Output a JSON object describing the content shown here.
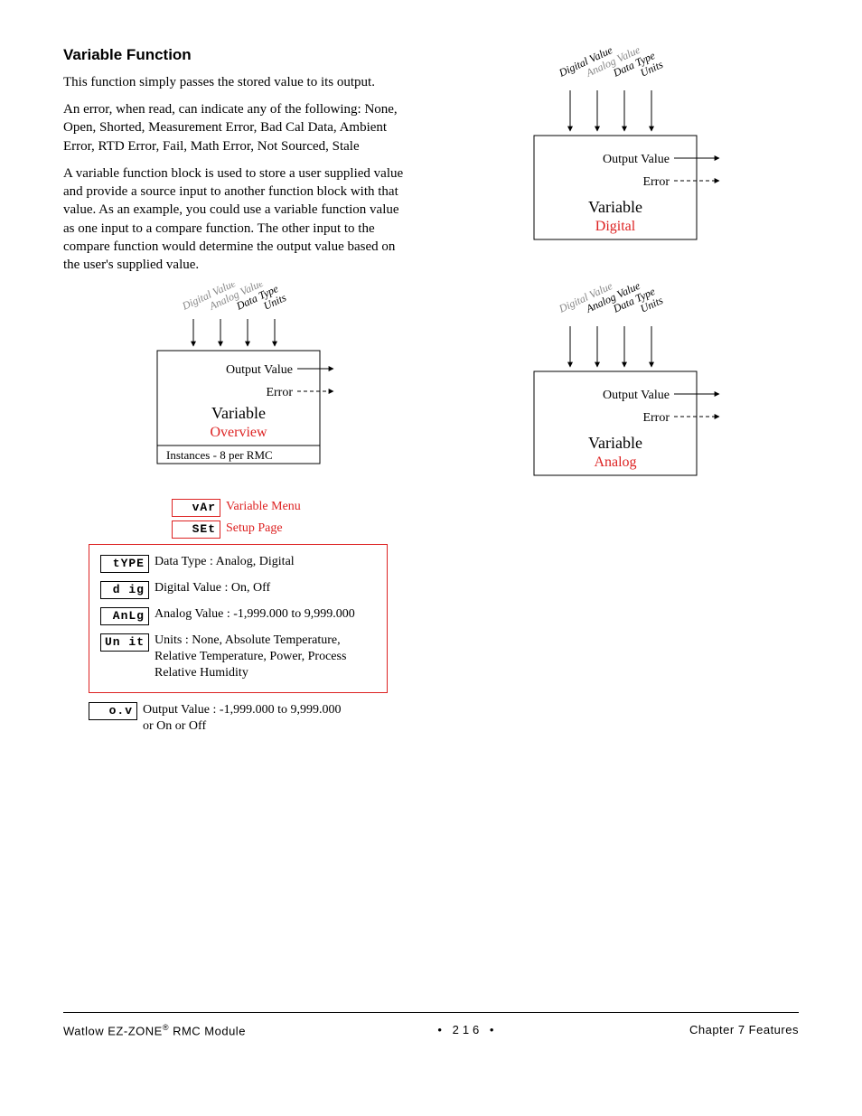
{
  "title": "Variable Function",
  "para1": "This function simply passes the stored value to its output.",
  "para2": "An error, when read, can indicate any of the following: None, Open, Shorted, Measurement Error, Bad Cal Data, Ambient Error, RTD Error, Fail, Math Error, Not Sourced, Stale",
  "para3": "A variable function block is used to store a user supplied value and provide a source input to another function block with that value. As an example, you could use a variable function value as one input to a compare function. The other input to the compare function would determine the output value based on the user's supplied value.",
  "diagram_common": {
    "inputs": {
      "digital_value": "Digital Value",
      "analog_value": "Analog Value",
      "data_type": "Data Type",
      "units": "Units"
    },
    "output_value": "Output Value",
    "error": "Error",
    "variable": "Variable"
  },
  "diagram_overview": {
    "subtitle": "Overview",
    "instances": "Instances - 8 per RMC"
  },
  "diagram_digital": {
    "subtitle": "Digital"
  },
  "diagram_analog": {
    "subtitle": "Analog"
  },
  "menu": {
    "var_code": "vAr",
    "var_label": "Variable Menu",
    "set_code": "SEt",
    "set_label": "Setup Page"
  },
  "params": {
    "type": {
      "code": "tYPE",
      "text": "Data Type : Analog, Digital"
    },
    "dig": {
      "code": "d ig",
      "text": "Digital Value : On, Off"
    },
    "anlg": {
      "code": "AnLg",
      "text": "Analog Value : -1,999.000 to 9,999.000"
    },
    "unit": {
      "code": "Un it",
      "text": "Units : None, Absolute Temperature, Relative Temperature, Power, Process Relative Humidity"
    }
  },
  "output": {
    "code": "o.v",
    "text": "Output Value : -1,999.000 to 9,999.000 or On or Off"
  },
  "footer": {
    "left_brand": "Watlow EZ-ZONE",
    "left_suffix": " RMC Module",
    "center_bullet": "•",
    "page": "216",
    "right": "Chapter 7 Features"
  }
}
